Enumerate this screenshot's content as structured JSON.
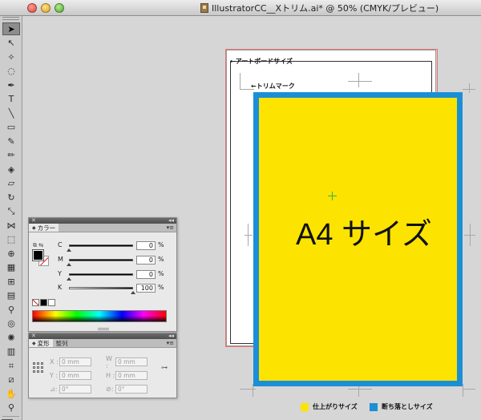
{
  "window": {
    "title": "IllustratorCC__Xトリム.ai* @ 50% (CMYK/プレビュー)"
  },
  "toolbar": {
    "tools": [
      {
        "name": "selection-tool",
        "glyph": "➤",
        "active": true
      },
      {
        "name": "direct-selection-tool",
        "glyph": "↖"
      },
      {
        "name": "magic-wand-tool",
        "glyph": "✧"
      },
      {
        "name": "lasso-tool",
        "glyph": "◌"
      },
      {
        "name": "pen-tool",
        "glyph": "✒"
      },
      {
        "name": "type-tool",
        "glyph": "T"
      },
      {
        "name": "line-tool",
        "glyph": "╲"
      },
      {
        "name": "rectangle-tool",
        "glyph": "▭"
      },
      {
        "name": "paintbrush-tool",
        "glyph": "✎"
      },
      {
        "name": "pencil-tool",
        "glyph": "✏"
      },
      {
        "name": "blob-brush-tool",
        "glyph": "◈"
      },
      {
        "name": "eraser-tool",
        "glyph": "▱"
      },
      {
        "name": "rotate-tool",
        "glyph": "↻"
      },
      {
        "name": "scale-tool",
        "glyph": "⤡"
      },
      {
        "name": "width-tool",
        "glyph": "⋈"
      },
      {
        "name": "free-transform-tool",
        "glyph": "⬚"
      },
      {
        "name": "shape-builder-tool",
        "glyph": "⊕"
      },
      {
        "name": "perspective-grid-tool",
        "glyph": "▦"
      },
      {
        "name": "mesh-tool",
        "glyph": "⊞"
      },
      {
        "name": "gradient-tool",
        "glyph": "▤"
      },
      {
        "name": "eyedropper-tool",
        "glyph": "⚲"
      },
      {
        "name": "blend-tool",
        "glyph": "◎"
      },
      {
        "name": "symbol-sprayer-tool",
        "glyph": "✺"
      },
      {
        "name": "column-graph-tool",
        "glyph": "▥"
      },
      {
        "name": "artboard-tool",
        "glyph": "⌗"
      },
      {
        "name": "slice-tool",
        "glyph": "⧄"
      },
      {
        "name": "hand-tool",
        "glyph": "✋"
      },
      {
        "name": "zoom-tool",
        "glyph": "⚲"
      }
    ]
  },
  "canvas": {
    "artboard_label": "←アートボードサイズ",
    "trim_label": "←トリムマーク",
    "a4_label": "A4 サイズ",
    "legend": [
      {
        "label": "仕上がりサイズ",
        "color": "#fde300"
      },
      {
        "label": "断ち落としサイズ",
        "color": "#1a8fd6"
      }
    ],
    "colors": {
      "finish": "#fde300",
      "bleed": "#1a8fd6"
    }
  },
  "color_panel": {
    "close_glyph": "✕",
    "collapse_glyph": "◂◂",
    "tab_label": "カラー",
    "menu_glyph": "▾≡",
    "mini_glyph": "⧉ ⇆",
    "sliders": [
      {
        "letter": "C",
        "value": "0",
        "unit": "%",
        "level": 0
      },
      {
        "letter": "M",
        "value": "0",
        "unit": "%",
        "level": 0
      },
      {
        "letter": "Y",
        "value": "0",
        "unit": "%",
        "level": 0
      },
      {
        "letter": "K",
        "value": "100",
        "unit": "%",
        "level": 1
      }
    ]
  },
  "transform_panel": {
    "close_glyph": "✕",
    "collapse_glyph": "◂◂",
    "tabs": [
      {
        "label": "変形",
        "active": true
      },
      {
        "label": "整列",
        "active": false
      }
    ],
    "menu_glyph": "▾≡",
    "fields": {
      "x": {
        "label": "X :",
        "value": "0 mm"
      },
      "y": {
        "label": "Y :",
        "value": "0 mm"
      },
      "w": {
        "label": "W :",
        "value": "0 mm"
      },
      "h": {
        "label": "H :",
        "value": "0 mm"
      },
      "rotate": {
        "label": "⊿:",
        "value": "0°"
      },
      "shear": {
        "label": "⊘:",
        "value": "0°"
      }
    },
    "link_glyph": "⊶"
  }
}
